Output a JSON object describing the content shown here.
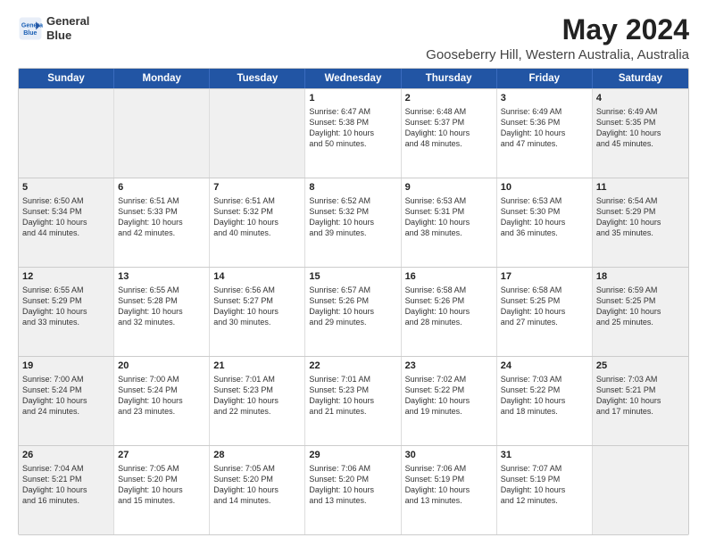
{
  "logo": {
    "line1": "General",
    "line2": "Blue"
  },
  "title": "May 2024",
  "subtitle": "Gooseberry Hill, Western Australia, Australia",
  "header_days": [
    "Sunday",
    "Monday",
    "Tuesday",
    "Wednesday",
    "Thursday",
    "Friday",
    "Saturday"
  ],
  "rows": [
    [
      {
        "day": "",
        "info": "",
        "shaded": true
      },
      {
        "day": "",
        "info": "",
        "shaded": true
      },
      {
        "day": "",
        "info": "",
        "shaded": true
      },
      {
        "day": "1",
        "info": "Sunrise: 6:47 AM\nSunset: 5:38 PM\nDaylight: 10 hours\nand 50 minutes.",
        "shaded": false
      },
      {
        "day": "2",
        "info": "Sunrise: 6:48 AM\nSunset: 5:37 PM\nDaylight: 10 hours\nand 48 minutes.",
        "shaded": false
      },
      {
        "day": "3",
        "info": "Sunrise: 6:49 AM\nSunset: 5:36 PM\nDaylight: 10 hours\nand 47 minutes.",
        "shaded": false
      },
      {
        "day": "4",
        "info": "Sunrise: 6:49 AM\nSunset: 5:35 PM\nDaylight: 10 hours\nand 45 minutes.",
        "shaded": true
      }
    ],
    [
      {
        "day": "5",
        "info": "Sunrise: 6:50 AM\nSunset: 5:34 PM\nDaylight: 10 hours\nand 44 minutes.",
        "shaded": true
      },
      {
        "day": "6",
        "info": "Sunrise: 6:51 AM\nSunset: 5:33 PM\nDaylight: 10 hours\nand 42 minutes.",
        "shaded": false
      },
      {
        "day": "7",
        "info": "Sunrise: 6:51 AM\nSunset: 5:32 PM\nDaylight: 10 hours\nand 40 minutes.",
        "shaded": false
      },
      {
        "day": "8",
        "info": "Sunrise: 6:52 AM\nSunset: 5:32 PM\nDaylight: 10 hours\nand 39 minutes.",
        "shaded": false
      },
      {
        "day": "9",
        "info": "Sunrise: 6:53 AM\nSunset: 5:31 PM\nDaylight: 10 hours\nand 38 minutes.",
        "shaded": false
      },
      {
        "day": "10",
        "info": "Sunrise: 6:53 AM\nSunset: 5:30 PM\nDaylight: 10 hours\nand 36 minutes.",
        "shaded": false
      },
      {
        "day": "11",
        "info": "Sunrise: 6:54 AM\nSunset: 5:29 PM\nDaylight: 10 hours\nand 35 minutes.",
        "shaded": true
      }
    ],
    [
      {
        "day": "12",
        "info": "Sunrise: 6:55 AM\nSunset: 5:29 PM\nDaylight: 10 hours\nand 33 minutes.",
        "shaded": true
      },
      {
        "day": "13",
        "info": "Sunrise: 6:55 AM\nSunset: 5:28 PM\nDaylight: 10 hours\nand 32 minutes.",
        "shaded": false
      },
      {
        "day": "14",
        "info": "Sunrise: 6:56 AM\nSunset: 5:27 PM\nDaylight: 10 hours\nand 30 minutes.",
        "shaded": false
      },
      {
        "day": "15",
        "info": "Sunrise: 6:57 AM\nSunset: 5:26 PM\nDaylight: 10 hours\nand 29 minutes.",
        "shaded": false
      },
      {
        "day": "16",
        "info": "Sunrise: 6:58 AM\nSunset: 5:26 PM\nDaylight: 10 hours\nand 28 minutes.",
        "shaded": false
      },
      {
        "day": "17",
        "info": "Sunrise: 6:58 AM\nSunset: 5:25 PM\nDaylight: 10 hours\nand 27 minutes.",
        "shaded": false
      },
      {
        "day": "18",
        "info": "Sunrise: 6:59 AM\nSunset: 5:25 PM\nDaylight: 10 hours\nand 25 minutes.",
        "shaded": true
      }
    ],
    [
      {
        "day": "19",
        "info": "Sunrise: 7:00 AM\nSunset: 5:24 PM\nDaylight: 10 hours\nand 24 minutes.",
        "shaded": true
      },
      {
        "day": "20",
        "info": "Sunrise: 7:00 AM\nSunset: 5:24 PM\nDaylight: 10 hours\nand 23 minutes.",
        "shaded": false
      },
      {
        "day": "21",
        "info": "Sunrise: 7:01 AM\nSunset: 5:23 PM\nDaylight: 10 hours\nand 22 minutes.",
        "shaded": false
      },
      {
        "day": "22",
        "info": "Sunrise: 7:01 AM\nSunset: 5:23 PM\nDaylight: 10 hours\nand 21 minutes.",
        "shaded": false
      },
      {
        "day": "23",
        "info": "Sunrise: 7:02 AM\nSunset: 5:22 PM\nDaylight: 10 hours\nand 19 minutes.",
        "shaded": false
      },
      {
        "day": "24",
        "info": "Sunrise: 7:03 AM\nSunset: 5:22 PM\nDaylight: 10 hours\nand 18 minutes.",
        "shaded": false
      },
      {
        "day": "25",
        "info": "Sunrise: 7:03 AM\nSunset: 5:21 PM\nDaylight: 10 hours\nand 17 minutes.",
        "shaded": true
      }
    ],
    [
      {
        "day": "26",
        "info": "Sunrise: 7:04 AM\nSunset: 5:21 PM\nDaylight: 10 hours\nand 16 minutes.",
        "shaded": true
      },
      {
        "day": "27",
        "info": "Sunrise: 7:05 AM\nSunset: 5:20 PM\nDaylight: 10 hours\nand 15 minutes.",
        "shaded": false
      },
      {
        "day": "28",
        "info": "Sunrise: 7:05 AM\nSunset: 5:20 PM\nDaylight: 10 hours\nand 14 minutes.",
        "shaded": false
      },
      {
        "day": "29",
        "info": "Sunrise: 7:06 AM\nSunset: 5:20 PM\nDaylight: 10 hours\nand 13 minutes.",
        "shaded": false
      },
      {
        "day": "30",
        "info": "Sunrise: 7:06 AM\nSunset: 5:19 PM\nDaylight: 10 hours\nand 13 minutes.",
        "shaded": false
      },
      {
        "day": "31",
        "info": "Sunrise: 7:07 AM\nSunset: 5:19 PM\nDaylight: 10 hours\nand 12 minutes.",
        "shaded": false
      },
      {
        "day": "",
        "info": "",
        "shaded": true
      }
    ]
  ]
}
